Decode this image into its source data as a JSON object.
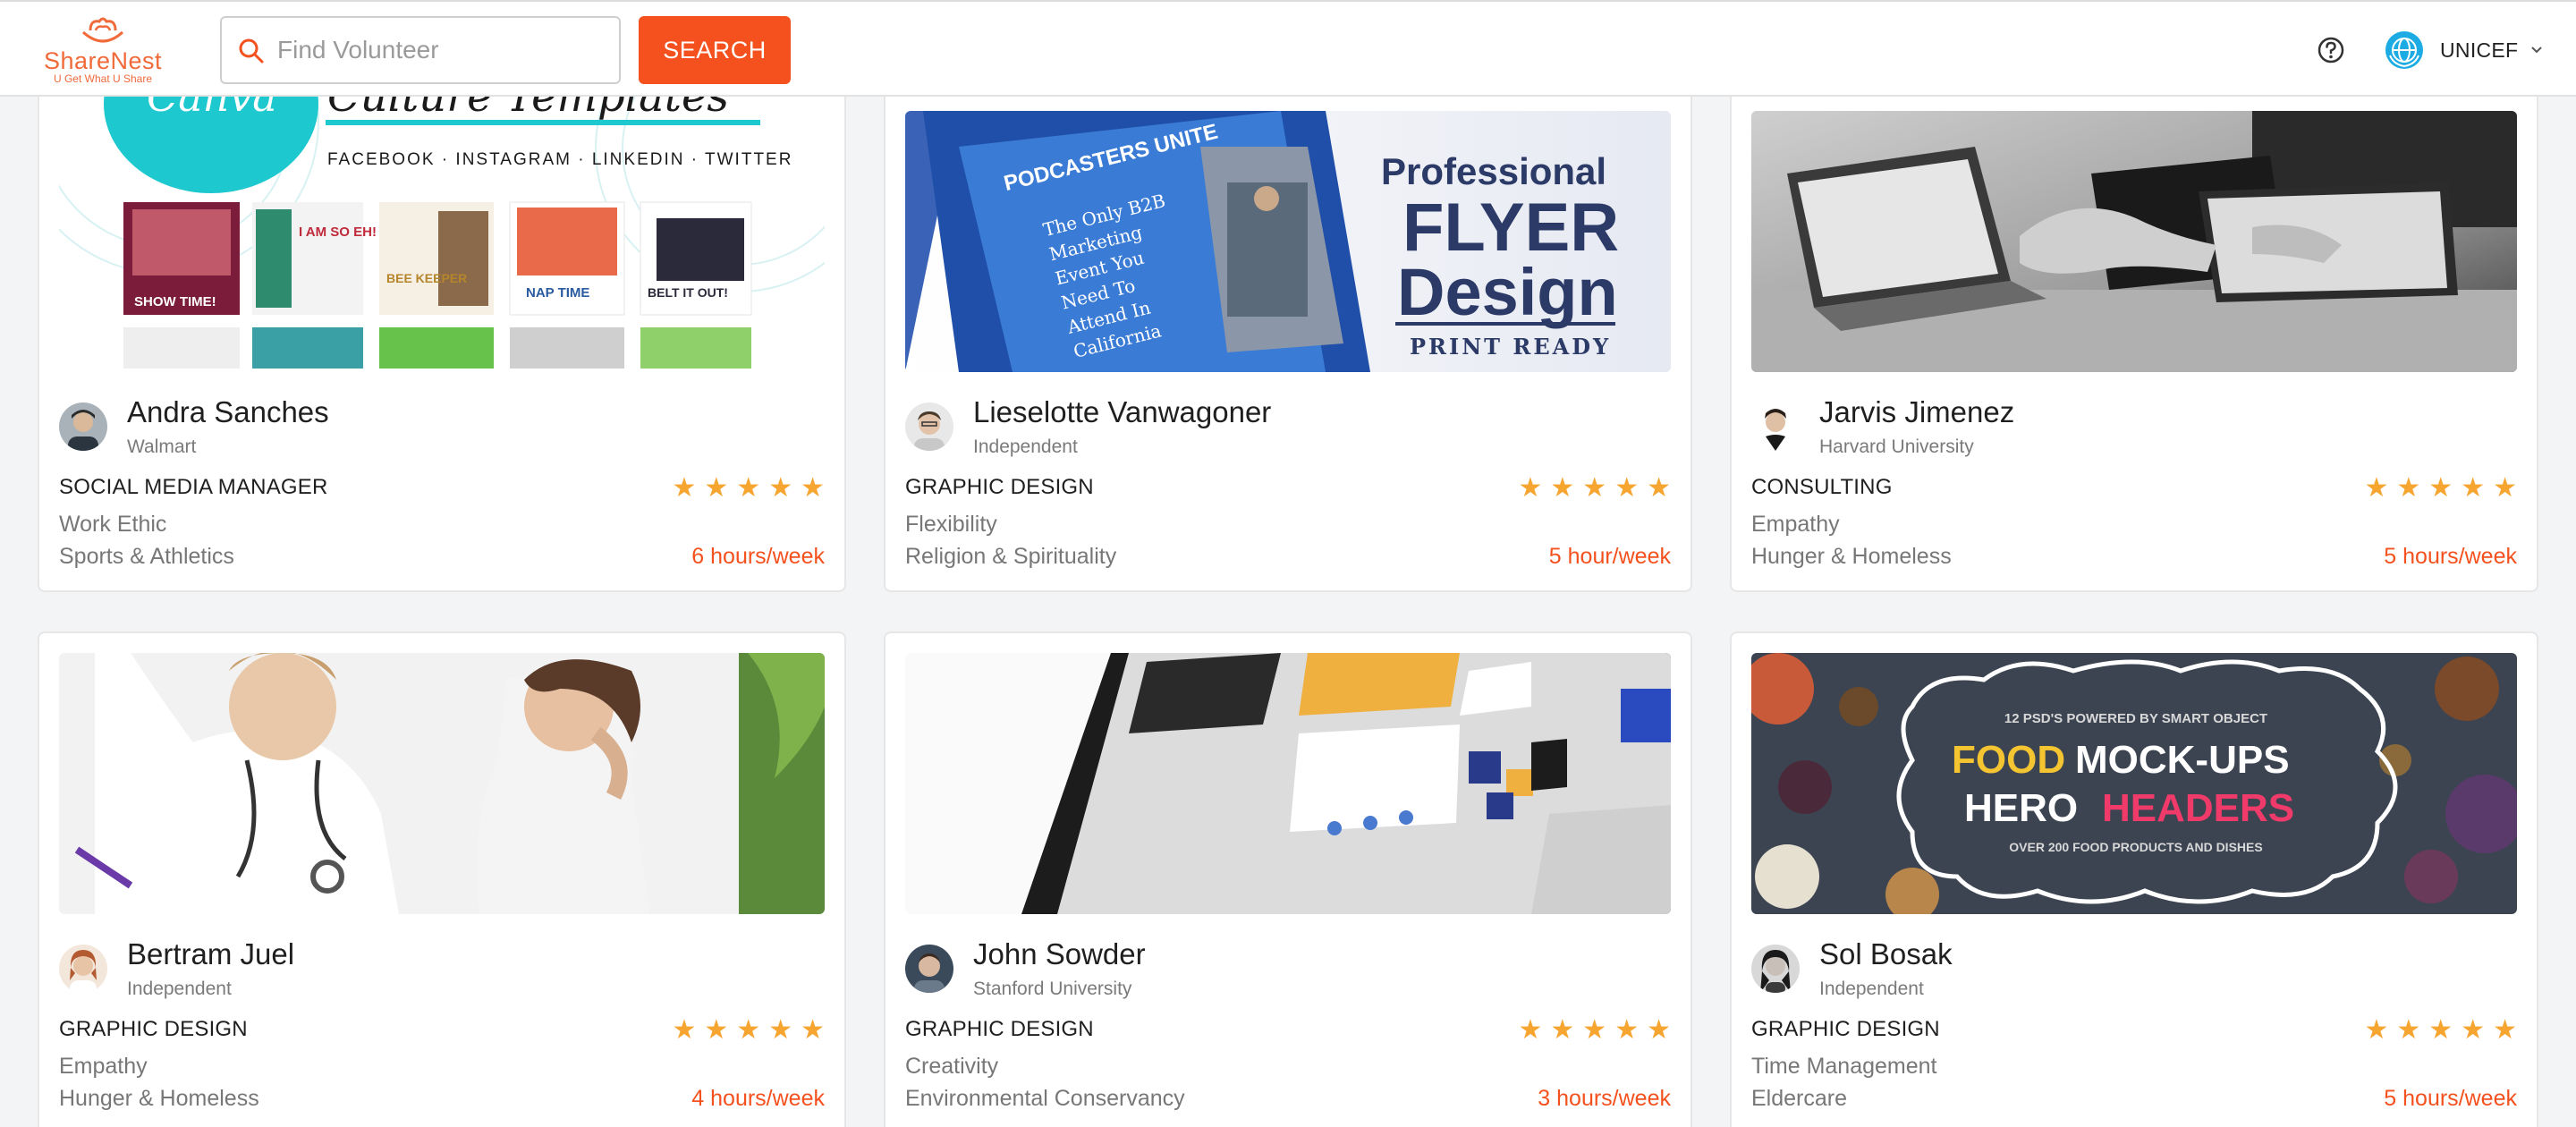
{
  "header": {
    "logo_name": "ShareNest",
    "logo_tagline": "U Get What U Share",
    "search_placeholder": "Find Volunteer",
    "search_button": "SEARCH",
    "org_name": "UNICEF",
    "icons": [
      "search-icon",
      "help-icon",
      "unicef-globe-icon",
      "chevron-down-icon"
    ]
  },
  "colors": {
    "accent": "#f4511e",
    "star": "#f7a531",
    "unicef_blue": "#1cabe2"
  },
  "volunteers": [
    {
      "name": "Andra Sanches",
      "org": "Walmart",
      "role": "SOCIAL MEDIA MANAGER",
      "rating": 5,
      "skill": "Work Ethic",
      "cause": "Sports & Athletics",
      "hours": "6 hours/week",
      "image_text": {
        "headline": "Canva Culture Templates",
        "networks": "FACEBOOK · INSTAGRAM · LINKEDIN · TWITTER",
        "tiles": [
          "SHOW TIME!",
          "I AM SO EH!",
          "BEE KEEPER",
          "NAP TIME",
          "BELT IT OUT!"
        ]
      }
    },
    {
      "name": "Lieselotte Vanwagoner",
      "org": "Independent",
      "role": "GRAPHIC DESIGN",
      "rating": 5,
      "skill": "Flexibility",
      "cause": "Religion & Spirituality",
      "hours": "5 hour/week",
      "image_text": {
        "line1": "Professional",
        "line2": "FLYER",
        "line3": "Design",
        "line4": "PRINT READY",
        "flyer_title": "PODCASTERS UNITE",
        "flyer_body": [
          "The Only B2B",
          "Marketing",
          "Event You",
          "Need To",
          "Attend In",
          "California"
        ]
      }
    },
    {
      "name": "Jarvis Jimenez",
      "org": "Harvard University",
      "role": "CONSULTING",
      "rating": 5,
      "skill": "Empathy",
      "cause": "Hunger & Homeless",
      "hours": "5 hours/week"
    },
    {
      "name": "Bertram Juel",
      "org": "Independent",
      "role": "GRAPHIC DESIGN",
      "rating": 5,
      "skill": "Empathy",
      "cause": "Hunger & Homeless",
      "hours": "4 hours/week"
    },
    {
      "name": "John Sowder",
      "org": "Stanford University",
      "role": "GRAPHIC DESIGN",
      "rating": 5,
      "skill": "Creativity",
      "cause": "Environmental Conservancy",
      "hours": "3 hours/week"
    },
    {
      "name": "Sol Bosak",
      "org": "Independent",
      "role": "GRAPHIC DESIGN",
      "rating": 5,
      "skill": "Time Management",
      "cause": "Eldercare",
      "hours": "5 hours/week",
      "image_text": {
        "top": "12 PSD'S POWERED BY SMART OBJECT",
        "w1": "FOOD",
        "w2": "MOCK-UPS",
        "w3": "HERO",
        "w4": "HEADERS",
        "bottom": "OVER 200 FOOD PRODUCTS AND DISHES"
      }
    }
  ]
}
